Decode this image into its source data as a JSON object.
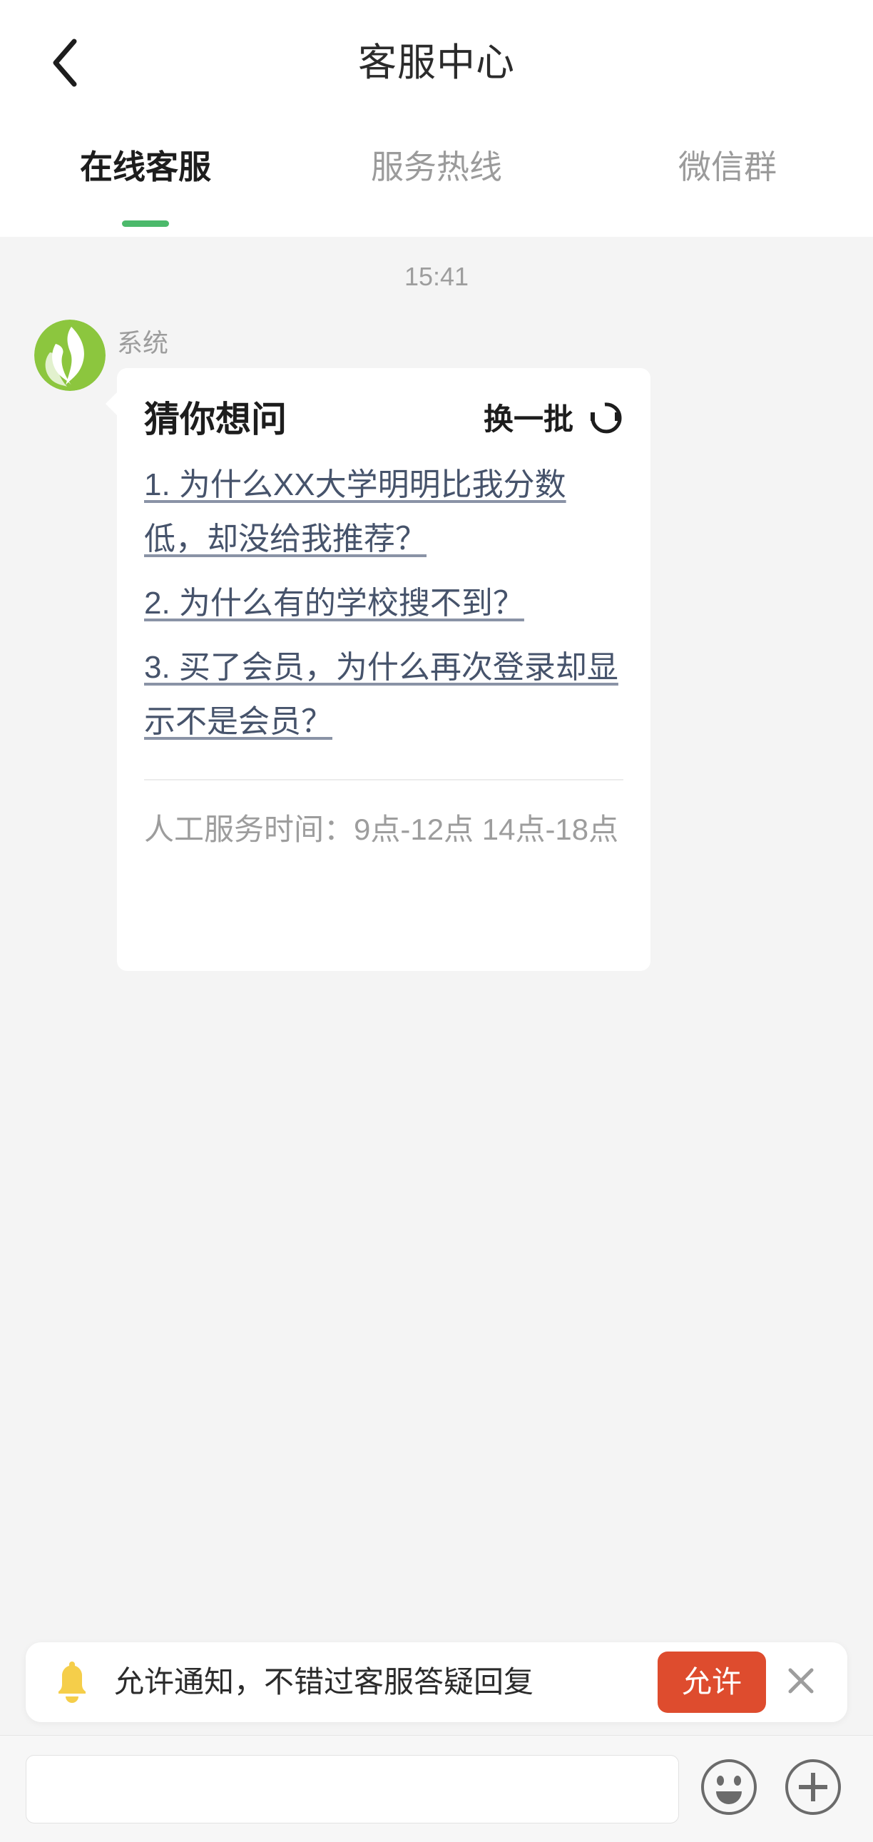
{
  "header": {
    "back_icon": "chevron-left-icon",
    "title": "客服中心"
  },
  "tabs": [
    {
      "label": "在线客服",
      "active": true
    },
    {
      "label": "服务热线",
      "active": false
    },
    {
      "label": "微信群",
      "active": false
    }
  ],
  "chat": {
    "timestamp": "15:41",
    "message": {
      "sender": "系统",
      "avatar_icon": "system-leaf-logo",
      "card": {
        "title": "猜你想问",
        "refresh_label": "换一批",
        "refresh_icon": "refresh-icon",
        "questions": [
          "1. 为什么XX大学明明比我分数低，却没给我推荐？",
          "2. 为什么有的学校搜不到？",
          "3. 买了会员，为什么再次登录却显示不是会员？"
        ],
        "service_hours": "人工服务时间：9点-12点 14点-18点"
      }
    }
  },
  "notice": {
    "bell_icon": "bell-icon",
    "text": "允许通知，不错过客服答疑回复",
    "allow_label": "允许",
    "close_icon": "close-icon"
  },
  "input_bar": {
    "value": "",
    "placeholder": "",
    "emoji_icon": "smiley-icon",
    "plus_icon": "plus-icon"
  },
  "colors": {
    "tab_accent": "#4cb96b",
    "link": "#46536b",
    "allow_button": "#de4c2e",
    "bell": "#f5ce4a",
    "avatar_green": "#8cc63e",
    "page_bg": "#f4f4f4"
  }
}
